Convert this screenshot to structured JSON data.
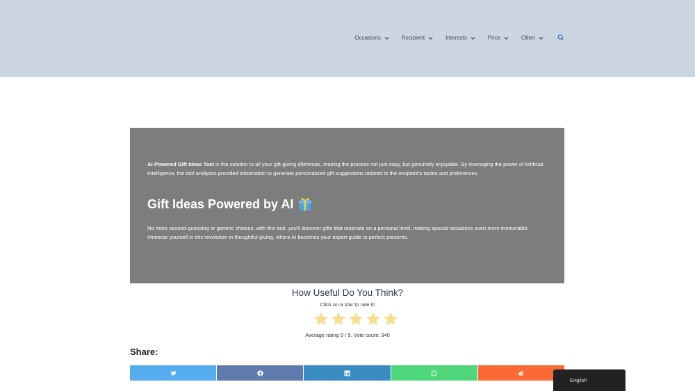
{
  "nav": {
    "items": [
      {
        "label": "Occasions"
      },
      {
        "label": "Recipient"
      },
      {
        "label": "Interests"
      },
      {
        "label": "Price"
      },
      {
        "label": "Other"
      }
    ],
    "search_icon": "search-icon"
  },
  "hero": {
    "intro_bold": "AI-Powered Gift Ideas Tool",
    "intro_rest": " is the solution to all your gift-giving dilemmas, making the process not just easy, but genuinely enjoyable. By leveraging the power of Artificial Intelligence, the tool analyzes provided information to generate personalized gift suggestions tailored to the recipient's tastes and preferences.",
    "heading": "Gift Ideas Powered by AI",
    "heading_icon": "gift-icon",
    "body": "No more second-guessing or generic choices; with this tool, you'll discover gifts that resonate on a personal level, making special occasions even more memorable. Immerse yourself in this revolution in thoughtful giving, where AI becomes your expert guide to perfect presents."
  },
  "rating": {
    "title": "How Useful Do You Think?",
    "subtitle": "Click on a star to rate it!",
    "stars": 5,
    "max_stars": 5,
    "star_color": "#f6de8c",
    "summary": "Average rating 5 / 5. Vote count: 340"
  },
  "share": {
    "title": "Share:",
    "buttons": [
      {
        "icon": "twitter-icon",
        "color": "#55acee"
      },
      {
        "icon": "facebook-icon",
        "color": "#5f7bad"
      },
      {
        "icon": "linkedin-icon",
        "color": "#3a8dc3"
      },
      {
        "icon": "whatsapp-icon",
        "color": "#4fd67a"
      },
      {
        "icon": "reddit-icon",
        "color": "#fb6a34"
      }
    ]
  },
  "language": {
    "label": "English"
  }
}
